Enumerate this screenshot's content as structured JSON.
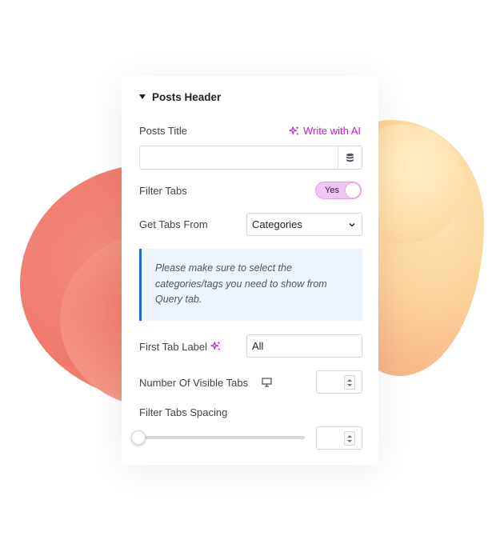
{
  "section": {
    "title": "Posts Header",
    "caret_icon": "caret-down-icon"
  },
  "posts_title": {
    "label": "Posts Title",
    "ai_link": "Write with AI",
    "ai_icon": "sparkle-icon",
    "value": "",
    "dynamic_icon": "database-icon"
  },
  "filter_tabs": {
    "label": "Filter Tabs",
    "toggle_label": "Yes",
    "enabled": true
  },
  "get_tabs_from": {
    "label": "Get Tabs From",
    "selected": "Categories",
    "chevron_icon": "chevron-down-icon"
  },
  "notice": {
    "text": "Please make sure to select the categories/tags you need to show from Query tab."
  },
  "first_tab_label": {
    "label": "First Tab Label",
    "ai_icon": "sparkle-icon",
    "value": "All"
  },
  "visible_tabs": {
    "label": "Number Of Visible Tabs",
    "device_icon": "desktop-icon",
    "value": ""
  },
  "spacing": {
    "label": "Filter Tabs Spacing",
    "slider_value": 0,
    "value": ""
  },
  "colors": {
    "accent": "#c31ec9",
    "toggle_bg": "#f3c5f5",
    "notice_border": "#2563d6",
    "notice_bg": "#edf4fd"
  }
}
